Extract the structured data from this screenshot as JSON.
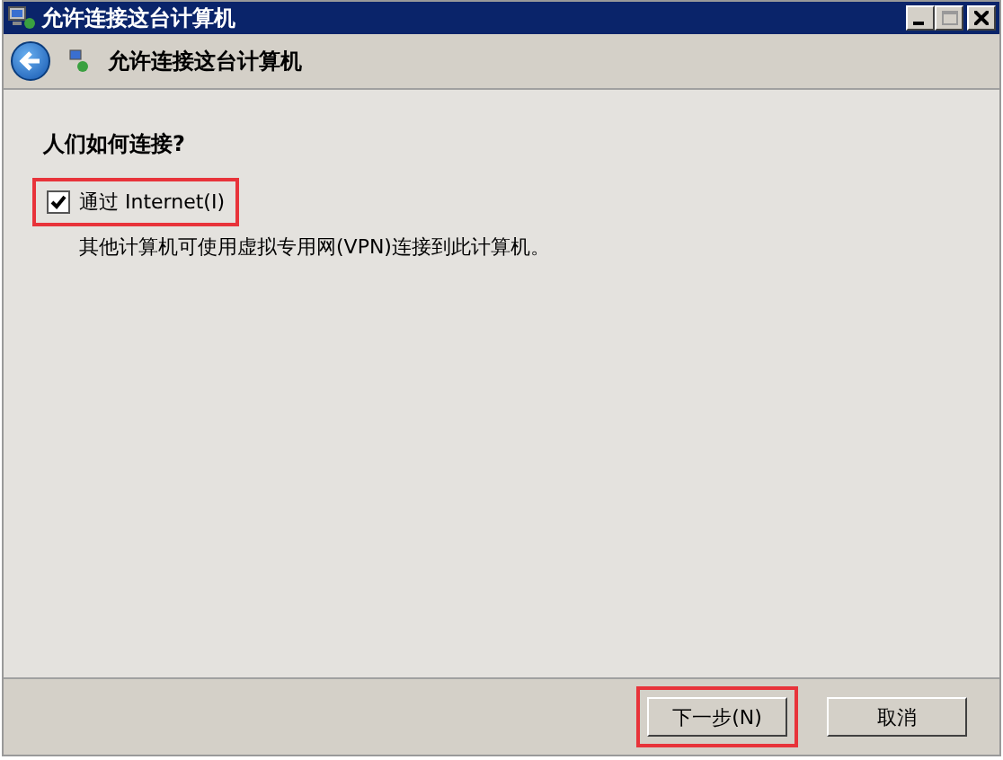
{
  "window": {
    "title": "允许连接这台计算机"
  },
  "header": {
    "title": "允许连接这台计算机"
  },
  "question": "人们如何连接?",
  "option": {
    "label": "通过 Internet(I)",
    "checked": true,
    "description": "其他计算机可使用虚拟专用网(VPN)连接到此计算机。",
    "highlighted": true
  },
  "buttons": [
    {
      "label": "下一步(N)",
      "highlighted": true
    },
    {
      "label": "取消",
      "highlighted": false
    }
  ]
}
